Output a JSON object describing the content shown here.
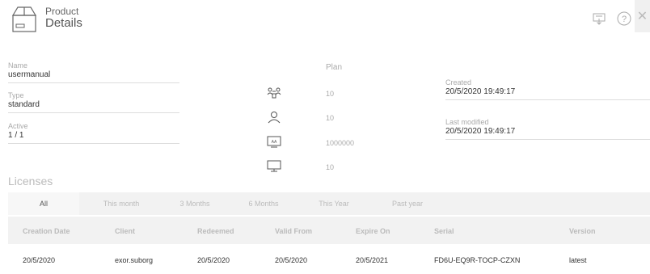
{
  "header": {
    "title_line1": "Product",
    "title_line2": "Details",
    "icons": {
      "product": "box-icon",
      "export": "monitor-download-icon",
      "help": "help-circle-icon",
      "close": "close-icon"
    },
    "close_glyph": "✕"
  },
  "fields": {
    "name": {
      "label": "Name",
      "value": "usermanual"
    },
    "type": {
      "label": "Type",
      "value": "standard"
    },
    "active": {
      "label": "Active",
      "value": "1 / 1"
    }
  },
  "plan": {
    "title": "Plan",
    "rows": [
      {
        "icon": "network-users-icon",
        "value": "10"
      },
      {
        "icon": "user-icon",
        "value": "10"
      },
      {
        "icon": "data-screen-icon",
        "value": "1000000"
      },
      {
        "icon": "monitor-icon",
        "value": "10"
      }
    ]
  },
  "dates": {
    "created": {
      "label": "Created",
      "value": "20/5/2020 19:49:17"
    },
    "last_modified": {
      "label": "Last modified",
      "value": "20/5/2020 19:49:17"
    }
  },
  "licenses": {
    "title": "Licenses",
    "tabs": [
      "All",
      "This month",
      "3 Months",
      "6 Months",
      "This Year",
      "Past year"
    ],
    "active_tab": "All",
    "columns": [
      "Creation Date",
      "Client",
      "Redeemed",
      "Valid From",
      "Expire On",
      "Serial",
      "Version"
    ],
    "rows": [
      [
        "20/5/2020",
        "exor.suborg",
        "20/5/2020",
        "20/5/2020",
        "20/5/2021",
        "FD6U-EQ9R-TOCP-CZXN",
        "latest"
      ]
    ]
  },
  "colors": {
    "label_gray": "#aaaaaa",
    "header_bg": "#f2f2f2",
    "text": "#333333"
  }
}
